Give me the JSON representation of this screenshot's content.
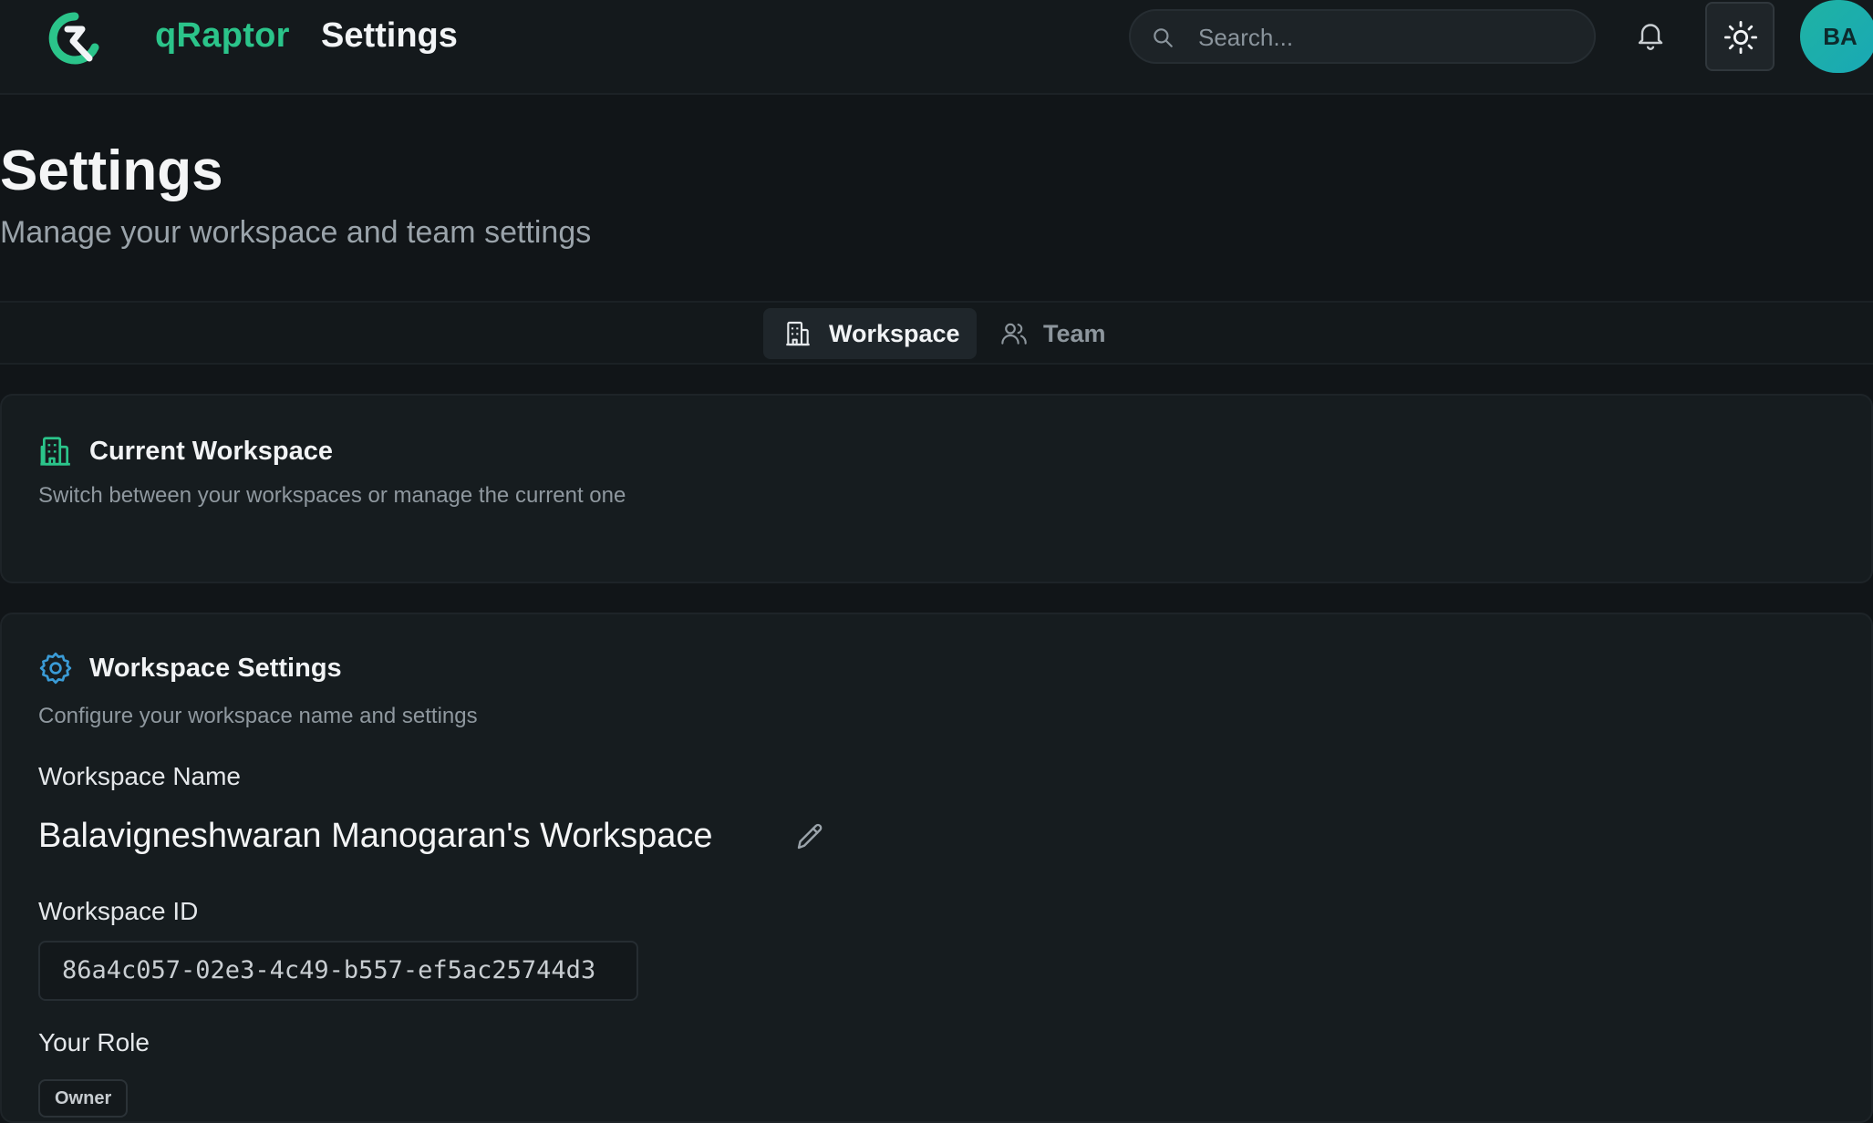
{
  "header": {
    "brand": "qRaptor",
    "title": "Settings",
    "search_placeholder": "Search...",
    "avatar_initials": "BA"
  },
  "page": {
    "title": "Settings",
    "subtitle": "Manage your workspace and team settings"
  },
  "tabs": [
    {
      "label": "Workspace",
      "icon": "building-icon",
      "active": true
    },
    {
      "label": "Team",
      "icon": "users-icon",
      "active": false
    }
  ],
  "current_workspace": {
    "title": "Current Workspace",
    "description": "Switch between your workspaces or manage the current one"
  },
  "workspace_settings": {
    "title": "Workspace Settings",
    "description": "Configure your workspace name and settings",
    "name_label": "Workspace Name",
    "name_value": "Balavigneshwaran Manogaran's Workspace",
    "id_label": "Workspace ID",
    "id_value": "86a4c057-02e3-4c49-b557-ef5ac25744d3",
    "role_label": "Your Role",
    "role_value": "Owner"
  },
  "colors": {
    "accent": "#2bc48a",
    "settings_icon": "#3a9bd6",
    "background": "#111518"
  }
}
